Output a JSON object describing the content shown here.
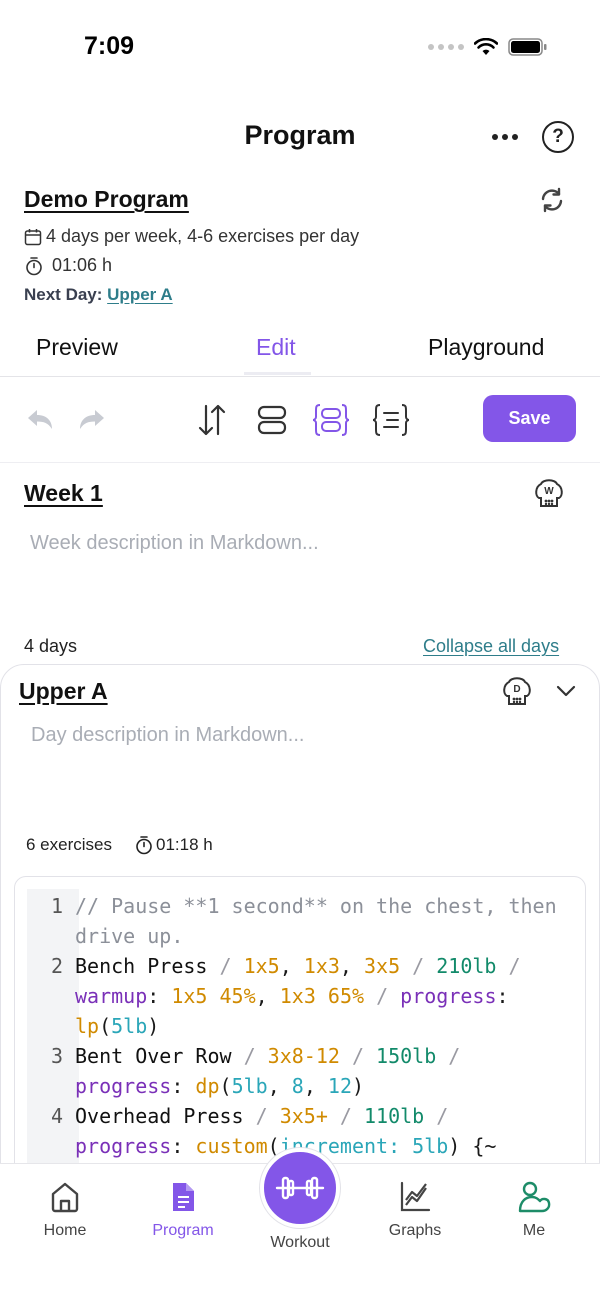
{
  "status_bar": {
    "time": "7:09"
  },
  "header": {
    "title": "Program"
  },
  "program": {
    "name": "Demo Program",
    "schedule": "4 days per week, 4-6 exercises per day",
    "duration": "01:06 h",
    "next_day_label": "Next Day:",
    "next_day_value": "Upper A"
  },
  "tabs": [
    {
      "label": "Preview",
      "active": false
    },
    {
      "label": "Edit",
      "active": true
    },
    {
      "label": "Playground",
      "active": false
    }
  ],
  "toolbar": {
    "save_label": "Save"
  },
  "week": {
    "title": "Week 1",
    "badge_letter": "W",
    "description_placeholder": "Week description in Markdown...",
    "days_count": "4 days",
    "collapse_label": "Collapse all days"
  },
  "day": {
    "title": "Upper A",
    "badge_letter": "D",
    "description_placeholder": "Day description in Markdown...",
    "exercises_count": "6 exercises",
    "duration": "01:18 h"
  },
  "code_lines": [
    {
      "n": "1",
      "text": "// Pause **1 second** on the chest, then drive up."
    },
    {
      "n": "2",
      "text": "Bench Press / 1x5, 1x3, 3x5 / 210lb / warmup: 1x5 45%, 1x3 65% / progress: lp(5lb)"
    },
    {
      "n": "3",
      "text": "Bent Over Row / 3x8-12 / 150lb / progress: dp(5lb, 8, 12)"
    },
    {
      "n": "4",
      "text": "Overhead Press / 3x5+ / 110lb / progress: custom(increment: 5lb) {~"
    }
  ],
  "bottom_nav": {
    "home": "Home",
    "program": "Program",
    "workout": "Workout",
    "graphs": "Graphs",
    "me": "Me"
  },
  "colors": {
    "accent": "#8356e8",
    "link": "#2e7d8a"
  }
}
